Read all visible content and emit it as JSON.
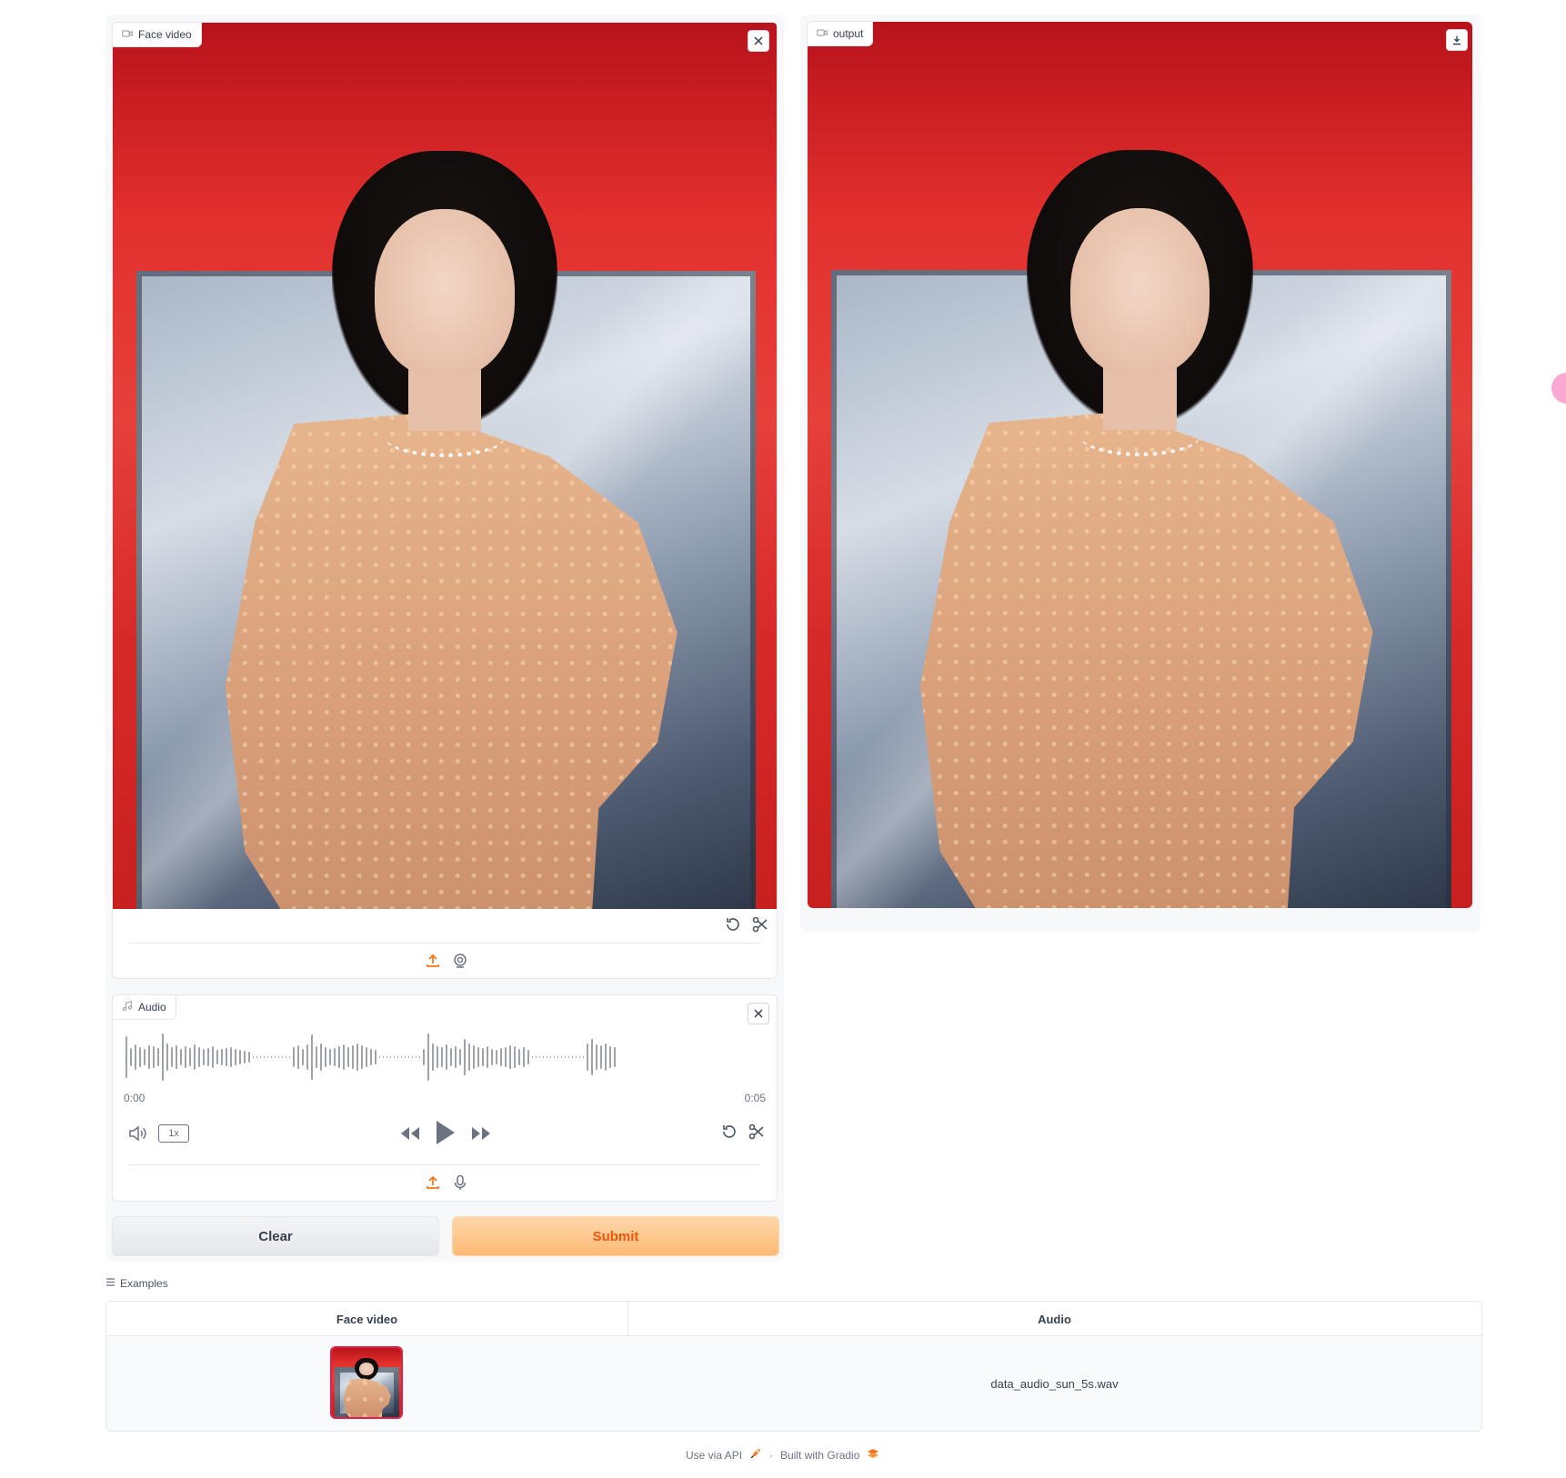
{
  "input_video": {
    "label": "Face video"
  },
  "output_video": {
    "label": "output"
  },
  "audio": {
    "label": "Audio",
    "time_start": "0:00",
    "time_end": "0:05",
    "speed": "1x"
  },
  "buttons": {
    "clear": "Clear",
    "submit": "Submit"
  },
  "examples": {
    "label": "Examples",
    "columns": [
      "Face video",
      "Audio"
    ],
    "rows": [
      {
        "audio": "data_audio_sun_5s.wav"
      }
    ]
  },
  "footer": {
    "api": "Use via API",
    "separator": "·",
    "built": "Built with Gradio"
  },
  "colors": {
    "accent": "#f97316",
    "submit_bg": "#fdba74",
    "background_red": "#e2302d"
  }
}
